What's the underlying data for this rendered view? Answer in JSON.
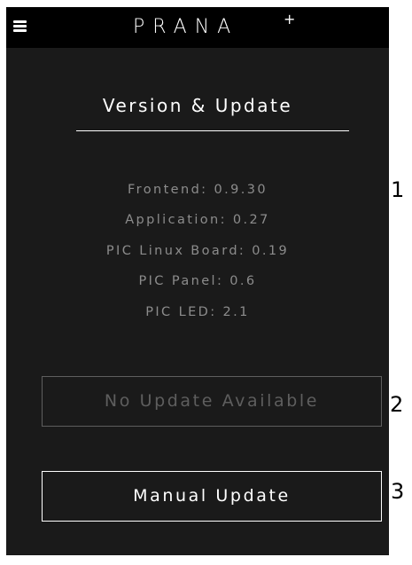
{
  "header": {
    "logo_text": "PRANA",
    "logo_sup": "+",
    "menu_icon": "hamburger-menu-icon"
  },
  "page": {
    "title": "Version & Update"
  },
  "versions": [
    "Frontend: 0.9.30",
    "Application: 0.27",
    "PIC Linux Board: 0.19",
    "PIC Panel: 0.6",
    "PIC LED: 2.1"
  ],
  "buttons": {
    "update_status_label": "No Update Available",
    "manual_update_label": "Manual Update"
  },
  "callouts": [
    "1",
    "2",
    "3"
  ],
  "colors": {
    "screen_background": "#1a1a1a",
    "header_background": "#000000",
    "text_primary": "#ffffff",
    "text_muted": "#8c8c8c",
    "disabled": "#5e5e5e"
  }
}
